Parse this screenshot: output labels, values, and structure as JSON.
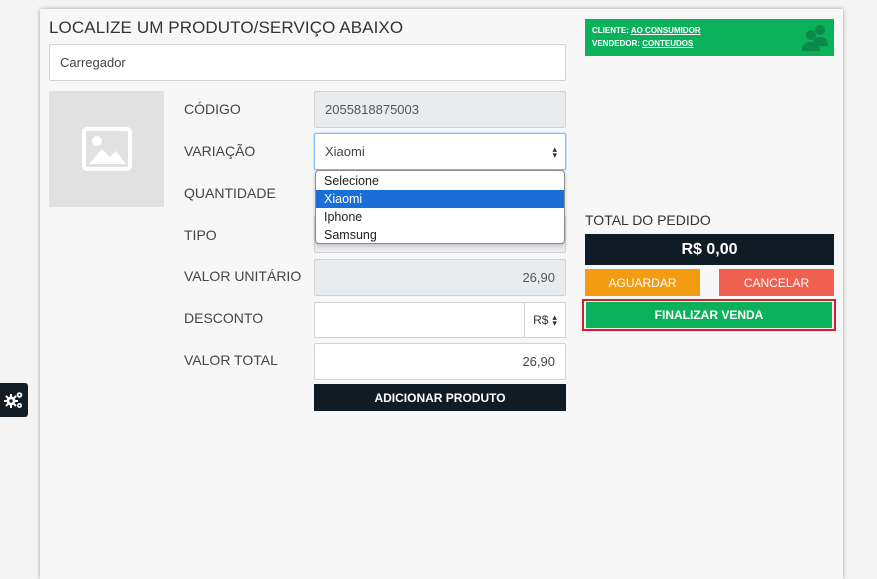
{
  "page": {
    "title": "LOCALIZE UM PRODUTO/SERVIÇO ABAIXO"
  },
  "search": {
    "value": "Carregador"
  },
  "form": {
    "codigo": {
      "label": "CÓDIGO",
      "value": "2055818875003"
    },
    "variacao": {
      "label": "VARIAÇÃO",
      "value": "Xiaomi",
      "options": [
        "Selecione",
        "Xiaomi",
        "Iphone",
        "Samsung"
      ],
      "highlighted": "Xiaomi"
    },
    "quantidade": {
      "label": "QUANTIDADE"
    },
    "tipo": {
      "label": "TIPO"
    },
    "valor_unitario": {
      "label": "VALOR UNITÁRIO",
      "value": "26,90"
    },
    "desconto": {
      "label": "DESCONTO",
      "value": "",
      "currency": "R$"
    },
    "valor_total": {
      "label": "VALOR TOTAL",
      "value": "26,90"
    },
    "add_button": "ADICIONAR PRODUTO"
  },
  "client": {
    "cliente_label": "CLIENTE:",
    "cliente_value": "AO CONSUMIDOR",
    "vendedor_label": "VENDEDOR:",
    "vendedor_value": "CONTEUDOS"
  },
  "order": {
    "total_label": "TOTAL DO PEDIDO",
    "total_value": "R$ 0,00",
    "wait_button": "AGUARDAR",
    "cancel_button": "CANCELAR",
    "finalize_button": "FINALIZAR VENDA"
  },
  "colors": {
    "green": "#0ab15a",
    "dark": "#0f1c26",
    "orange": "#f39c12",
    "red": "#f0604f",
    "highlight_outline": "#d21f2b",
    "dropdown_selected": "#1a6fd6"
  },
  "icons": {
    "image_placeholder": "image-icon",
    "users": "users-icon",
    "settings": "gears-icon",
    "select_arrows": "sort-arrows-icon"
  }
}
